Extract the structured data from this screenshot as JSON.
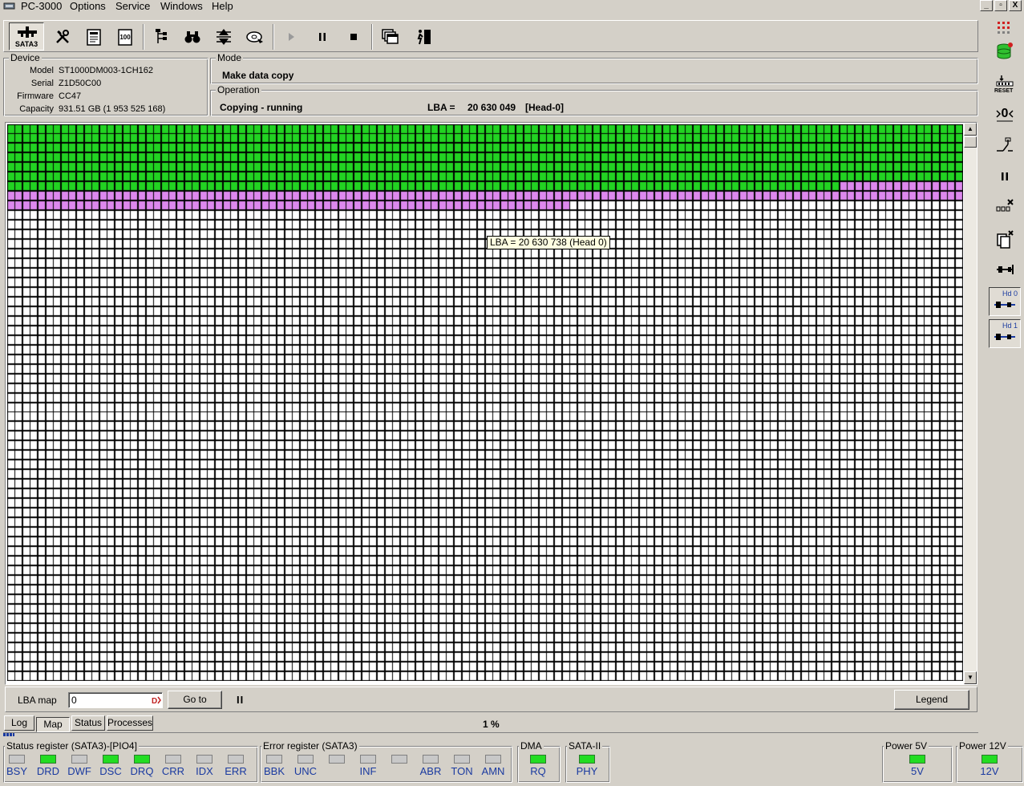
{
  "app": {
    "title": "PC-3000",
    "menu": [
      "Options",
      "Service",
      "Windows",
      "Help"
    ],
    "window_buttons": [
      "_",
      "▫",
      "X"
    ]
  },
  "toolbar": {
    "sata_label": "SATA3"
  },
  "device": {
    "title": "Device",
    "model_label": "Model",
    "model": "ST1000DM003-1CH162",
    "serial_label": "Serial",
    "serial": "Z1D50C00",
    "firmware_label": "Firmware",
    "firmware": "CC47",
    "capacity_label": "Capacity",
    "capacity": "931.51 GB (1 953 525 168)"
  },
  "mode": {
    "title": "Mode",
    "value": "Make data copy"
  },
  "operation": {
    "title": "Operation",
    "status": "Copying - running",
    "lba_label": "LBA =",
    "lba_value": "20 630 049",
    "head": "[Head-0]"
  },
  "map": {
    "tooltip": "LBA =  20 630 738 (Head 0)",
    "columns": 124,
    "rows": 58,
    "green_full_rows": 6,
    "green_partial_row_cells": 108,
    "pink_full_rows": 1,
    "pink_partial_row_cells": 73,
    "green_color": "#22d322",
    "pink_color": "#dd88ee",
    "empty_color": "#ffffff"
  },
  "controls": {
    "lba_map_label": "LBA map",
    "lba_input": "0",
    "goto_label": "Go to",
    "pause_label": "II",
    "legend_label": "Legend"
  },
  "tabs": [
    "Log",
    "Map",
    "Status",
    "Processes"
  ],
  "progress": {
    "label": "1 %"
  },
  "registers": {
    "status_title": "Status register (SATA3)-[PIO4]",
    "status_bits": [
      {
        "name": "BSY",
        "on": false
      },
      {
        "name": "DRD",
        "on": true
      },
      {
        "name": "DWF",
        "on": false
      },
      {
        "name": "DSC",
        "on": true
      },
      {
        "name": "DRQ",
        "on": true
      },
      {
        "name": "CRR",
        "on": false
      },
      {
        "name": "IDX",
        "on": false
      },
      {
        "name": "ERR",
        "on": false
      }
    ],
    "error_title": "Error register (SATA3)",
    "error_bits": [
      {
        "name": "BBK",
        "on": false
      },
      {
        "name": "UNC",
        "on": false
      },
      {
        "name": "",
        "on": false
      },
      {
        "name": "INF",
        "on": false
      },
      {
        "name": "",
        "on": false
      },
      {
        "name": "ABR",
        "on": false
      },
      {
        "name": "TON",
        "on": false
      },
      {
        "name": "AMN",
        "on": false
      }
    ],
    "dma_title": "DMA",
    "dma_bit": {
      "name": "RQ",
      "on": true
    },
    "sata_title": "SATA-II",
    "sata_bit": {
      "name": "PHY",
      "on": true
    },
    "power5_title": "Power 5V",
    "power5_bit": {
      "name": "5V",
      "on": true
    },
    "power12_title": "Power 12V",
    "power12_bit": {
      "name": "12V",
      "on": true
    }
  },
  "right_bar": {
    "reset_label": "RESET",
    "hd0_label": "Hd 0",
    "hd1_label": "Hd 1"
  }
}
